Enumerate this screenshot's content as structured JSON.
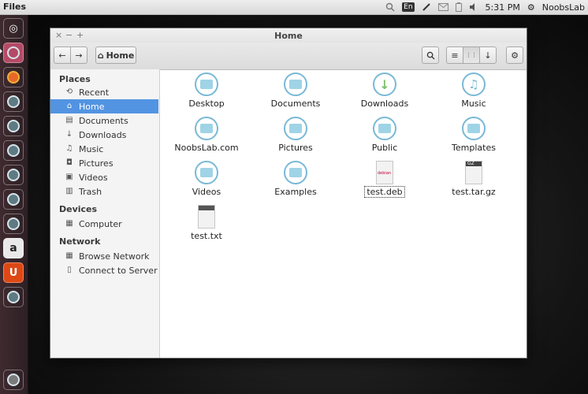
{
  "topbar": {
    "app": "Files",
    "lang": "En",
    "time": "5:31 PM",
    "user": "NoobsLab"
  },
  "window": {
    "title": "Home",
    "close": "×",
    "minimize": "−",
    "maximize": "+"
  },
  "toolbar": {
    "back": "←",
    "forward": "→",
    "location": "Home",
    "search": "search-icon",
    "list_view": "≡",
    "grid_view": "⋮⋮",
    "sort": "↓",
    "settings": "⚙"
  },
  "sidebar": {
    "sections": [
      {
        "title": "Places",
        "items": [
          {
            "label": "Recent",
            "icon": "⟲"
          },
          {
            "label": "Home",
            "icon": "⌂",
            "selected": true
          },
          {
            "label": "Documents",
            "icon": "▤"
          },
          {
            "label": "Downloads",
            "icon": "↓"
          },
          {
            "label": "Music",
            "icon": "♫"
          },
          {
            "label": "Pictures",
            "icon": "◘"
          },
          {
            "label": "Videos",
            "icon": "▣"
          },
          {
            "label": "Trash",
            "icon": "▥"
          }
        ]
      },
      {
        "title": "Devices",
        "items": [
          {
            "label": "Computer",
            "icon": "▦"
          }
        ]
      },
      {
        "title": "Network",
        "items": [
          {
            "label": "Browse Network",
            "icon": "▦"
          },
          {
            "label": "Connect to Server",
            "icon": "▯"
          }
        ]
      }
    ]
  },
  "files": [
    {
      "name": "Desktop",
      "kind": "folder"
    },
    {
      "name": "Documents",
      "kind": "folder"
    },
    {
      "name": "Downloads",
      "kind": "folder"
    },
    {
      "name": "Music",
      "kind": "folder"
    },
    {
      "name": "NoobsLab.com",
      "kind": "folder"
    },
    {
      "name": "Pictures",
      "kind": "folder"
    },
    {
      "name": "Public",
      "kind": "folder"
    },
    {
      "name": "Templates",
      "kind": "folder"
    },
    {
      "name": "Videos",
      "kind": "folder"
    },
    {
      "name": "Examples",
      "kind": "folder"
    },
    {
      "name": "test.deb",
      "kind": "deb",
      "selected": true,
      "badge": "debian"
    },
    {
      "name": "test.tar.gz",
      "kind": "archive",
      "badge": "GZ"
    },
    {
      "name": "test.txt",
      "kind": "text"
    }
  ],
  "colors": {
    "accent": "#5294e2",
    "folder": "#79b9d5"
  }
}
